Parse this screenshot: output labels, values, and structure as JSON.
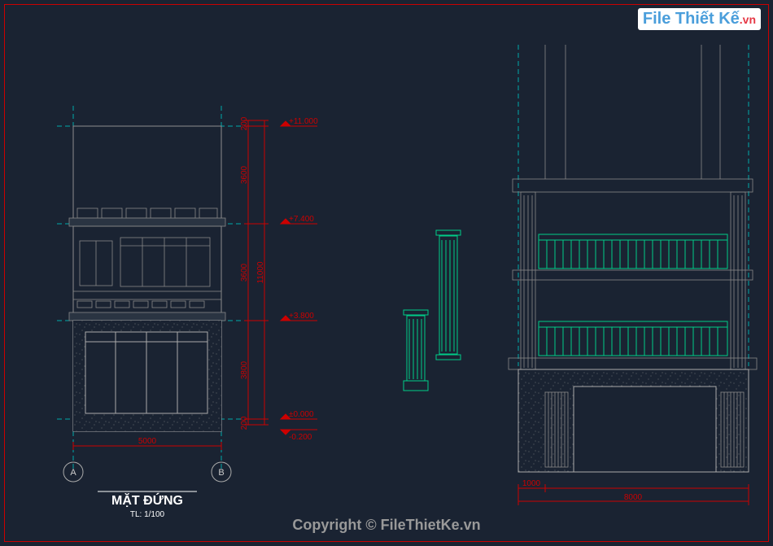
{
  "title": "MẶT ĐỨNG",
  "scale": "TL: 1/100",
  "axis": {
    "a": "A",
    "b": "B"
  },
  "dimensions": {
    "width_left": "5000",
    "d200_top": "200",
    "d3600_a": "3600",
    "d3600_b": "3600",
    "d11000": "11000",
    "d3800": "3800",
    "d200_bot": "200",
    "right_1000": "1000",
    "right_8000": "8000"
  },
  "elevations": {
    "e11": "+11.000",
    "e74": "+7.400",
    "e38": "+3.800",
    "e0": "±0.000",
    "en02": "-0.200"
  },
  "watermark": {
    "brand": "File Thiết Kế",
    "suffix": ".vn"
  },
  "copyright": "Copyright © FileThietKe.vn"
}
